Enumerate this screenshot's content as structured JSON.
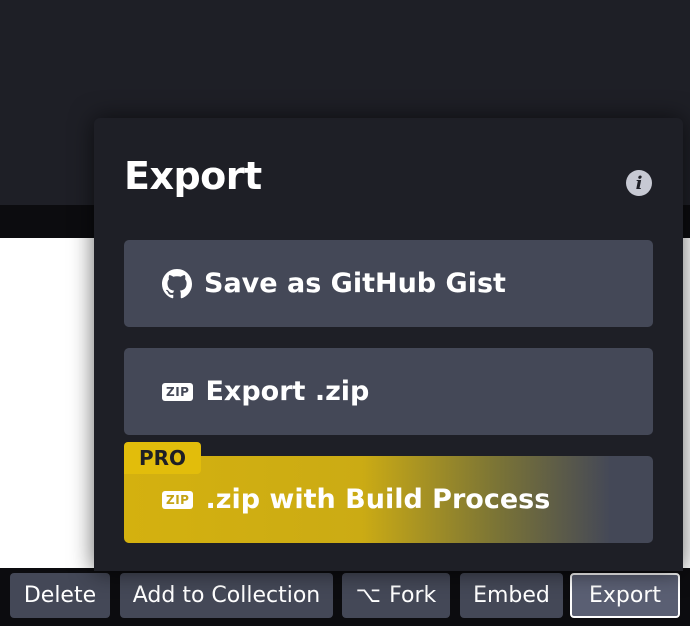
{
  "panel": {
    "title": "Export",
    "options": [
      {
        "label": "Save as GitHub Gist",
        "icon": "github-icon"
      },
      {
        "label": "Export .zip",
        "icon": "zip-icon",
        "badge_text": "ZIP"
      },
      {
        "label": ".zip with Build Process",
        "icon": "zip-icon",
        "badge_text": "ZIP",
        "tag": "PRO"
      }
    ],
    "info_icon_glyph": "i"
  },
  "footer": {
    "buttons": {
      "delete": "Delete",
      "add_to_collection": "Add to Collection",
      "fork": "Fork",
      "embed": "Embed",
      "export": "Export"
    },
    "fork_glyph": "⌥"
  },
  "colors": {
    "background": "#1e1f26",
    "button": "#444857",
    "pro_gold": "#e2bd0b"
  }
}
